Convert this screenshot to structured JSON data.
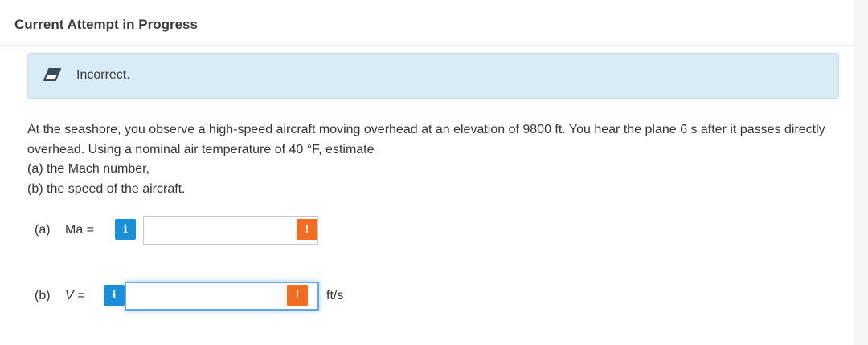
{
  "header": {
    "title": "Current Attempt in Progress"
  },
  "feedback": {
    "icon": "eraser-icon",
    "text": "Incorrect.",
    "background_color": "#d9ecf5"
  },
  "question": {
    "text": "At the seashore, you observe a high-speed aircraft moving overhead at an elevation of 9800 ft. You hear the plane 6 s after it passes directly overhead. Using a nominal air temperature of 40 °F, estimate",
    "part_a": "(a) the Mach number,",
    "part_b": "(b) the speed of the aircraft."
  },
  "answers": {
    "a": {
      "part": "(a)",
      "variable": "Ma =",
      "info_glyph": "i",
      "value": "",
      "placeholder": "",
      "warning_glyph": "!",
      "unit": ""
    },
    "b": {
      "part": "(b)",
      "variable": "V =",
      "info_glyph": "i",
      "value": "",
      "placeholder": "",
      "warning_glyph": "!",
      "unit": "ft/s"
    }
  },
  "colors": {
    "info_button": "#1a8fd9",
    "warning_flag": "#f26c21",
    "focus_ring": "#66a6e8"
  }
}
